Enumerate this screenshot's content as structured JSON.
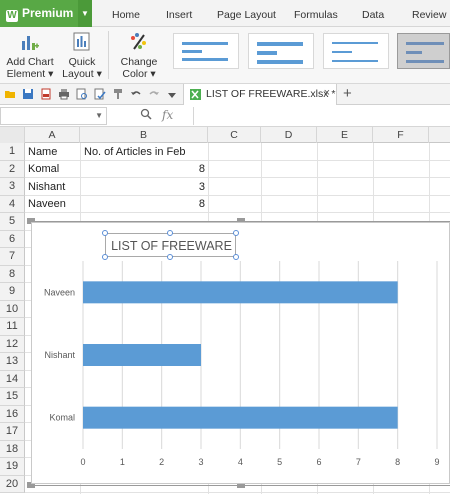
{
  "menubar": {
    "premium_label": "Premium",
    "tabs": [
      "Home",
      "Insert",
      "Page Layout",
      "Formulas",
      "Data",
      "Review"
    ]
  },
  "ribbon": {
    "add_chart_element": [
      "Add Chart",
      "Element ▾"
    ],
    "quick_layout": [
      "Quick",
      "Layout ▾"
    ],
    "change_color": [
      "Change",
      "Color ▾"
    ]
  },
  "qat": {
    "doc_tab_label": "LIST OF FREEWARE.xlsx *",
    "close_symbol": "×",
    "new_tab_symbol": "+"
  },
  "formula_bar": {
    "fx_symbol": "fx",
    "zoom_symbol": "🔍"
  },
  "grid": {
    "columns": [
      "A",
      "B",
      "C",
      "D",
      "E",
      "F"
    ],
    "rows": [
      "1",
      "2",
      "3",
      "4",
      "5",
      "6",
      "7",
      "8",
      "9",
      "10",
      "11",
      "12",
      "13",
      "14",
      "15",
      "16",
      "17",
      "18",
      "19",
      "20"
    ],
    "cells": {
      "A1": "Name",
      "B1": "No. of Articles in Feb",
      "A2": "Komal",
      "B2": "8",
      "A3": "Nishant",
      "B3": "3",
      "A4": "Naveen",
      "B4": "8"
    }
  },
  "chart_data": {
    "type": "bar",
    "orientation": "horizontal",
    "title": "LIST OF FREEWARE",
    "categories": [
      "Komal",
      "Nishant",
      "Naveen"
    ],
    "values": [
      8,
      3,
      8
    ],
    "xlim": [
      0,
      9
    ],
    "xticks": [
      "0",
      "1",
      "2",
      "3",
      "4",
      "5",
      "6",
      "7",
      "8",
      "9"
    ],
    "grid": true,
    "bar_color": "#5b9bd5"
  },
  "colors": {
    "premium_green": "#58a845",
    "bar_blue": "#5b9bd5"
  }
}
